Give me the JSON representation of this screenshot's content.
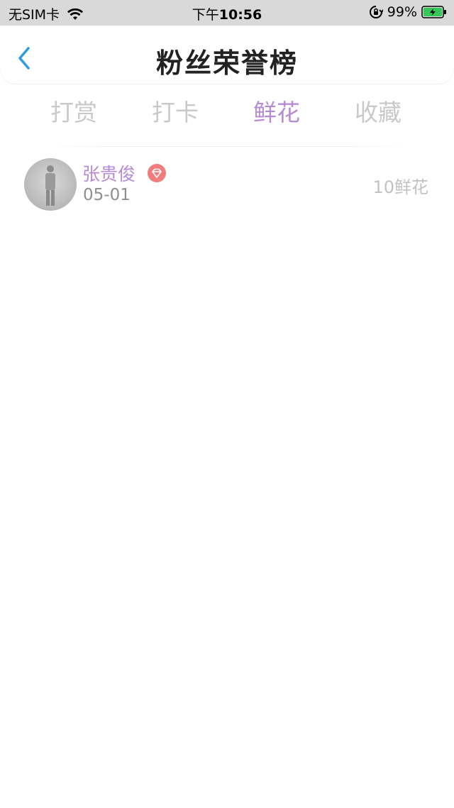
{
  "status_bar": {
    "carrier": "无SIM卡",
    "time_prefix": "下午",
    "time": "10:56",
    "battery_percent": "99%"
  },
  "nav": {
    "title": "粉丝荣誉榜"
  },
  "tabs": [
    {
      "label": "打赏",
      "active": false
    },
    {
      "label": "打卡",
      "active": false
    },
    {
      "label": "鲜花",
      "active": true
    },
    {
      "label": "收藏",
      "active": false
    }
  ],
  "list": [
    {
      "name": "张贵俊",
      "date": "05-01",
      "score": "10鲜花"
    }
  ],
  "colors": {
    "accent": "#b78bd4",
    "back_arrow": "#2d9be0",
    "badge": "#f07d7d",
    "battery": "#34c759"
  },
  "icons": {
    "back": "chevron-left-icon",
    "wifi": "wifi-icon",
    "orientation_lock": "orientation-lock-icon",
    "battery": "battery-charging-icon",
    "badge": "diamond-icon"
  }
}
